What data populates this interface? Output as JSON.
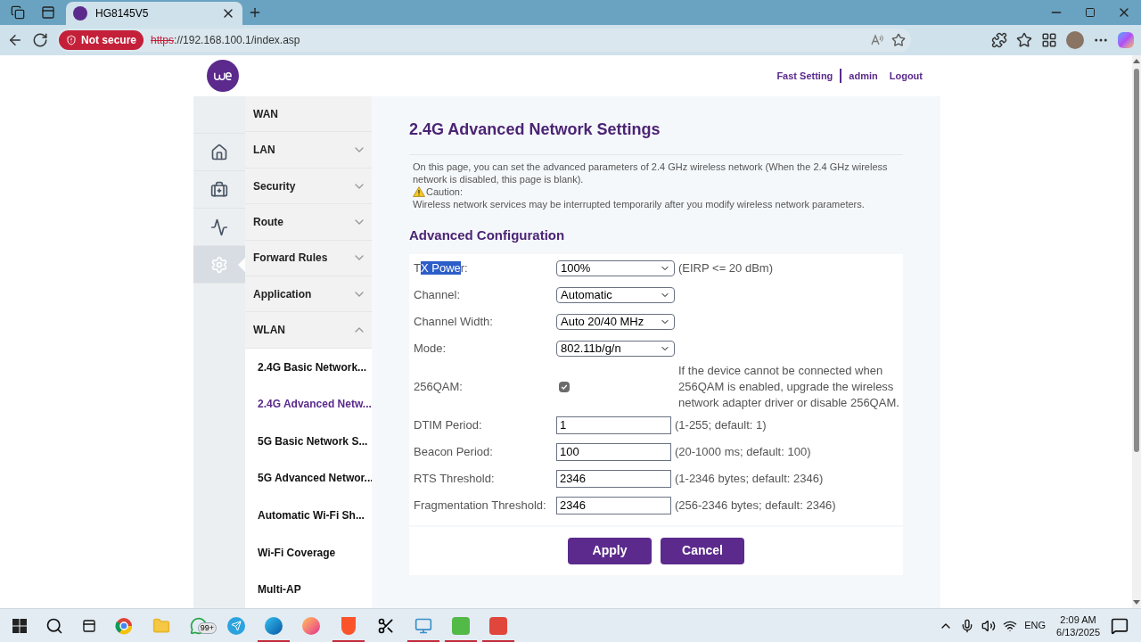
{
  "browser": {
    "tab_title": "HG8145V5",
    "security": "Not secure",
    "url_scheme": "https",
    "url_rest": "://192.168.100.1/index.asp"
  },
  "header": {
    "links": [
      "Fast Setting",
      "admin",
      "Logout"
    ]
  },
  "nav_icons": [
    {
      "kind": "home",
      "selected": false
    },
    {
      "kind": "kit",
      "selected": false
    },
    {
      "kind": "pulse",
      "selected": false
    },
    {
      "kind": "gear",
      "selected": true
    }
  ],
  "menu": [
    {
      "label": "WAN"
    },
    {
      "label": "LAN",
      "expanded": false
    },
    {
      "label": "Security",
      "expanded": false
    },
    {
      "label": "Route",
      "expanded": false
    },
    {
      "label": "Forward Rules",
      "expanded": false
    },
    {
      "label": "Application",
      "expanded": false
    },
    {
      "label": "WLAN",
      "expanded": true,
      "children": [
        {
          "label": "2.4G Basic Network...",
          "selected": false
        },
        {
          "label": "2.4G Advanced Netw...",
          "selected": true
        },
        {
          "label": "5G Basic Network S...",
          "selected": false
        },
        {
          "label": "5G Advanced Networ...",
          "selected": false
        },
        {
          "label": "Automatic Wi-Fi Sh...",
          "selected": false
        },
        {
          "label": "Wi-Fi Coverage",
          "selected": false
        },
        {
          "label": "Multi-AP",
          "selected": false
        }
      ]
    }
  ],
  "page": {
    "title": "2.4G Advanced Network Settings",
    "intro": "On this page, you can set the advanced parameters of 2.4 GHz wireless network (When the 2.4 GHz wireless network is disabled, this page is blank).",
    "caution": "Caution:",
    "caution_text": "Wireless network services may be interrupted temporarily after you modify wireless network parameters.",
    "section": "Advanced Configuration"
  },
  "fields": [
    {
      "kind": "select",
      "label_pre": "T",
      "label_selected": "X Powe",
      "label_post": "r:",
      "value": "100%",
      "hint": "(EIRP <= 20 dBm)"
    },
    {
      "kind": "select",
      "label_pre": "Channel:",
      "value": "Automatic"
    },
    {
      "kind": "select",
      "label_pre": "Channel Width:",
      "value": "Auto 20/40 MHz"
    },
    {
      "kind": "select",
      "label_pre": "Mode:",
      "value": "802.11b/g/n"
    },
    {
      "kind": "checkbox",
      "label_pre": "256QAM:",
      "checked": true,
      "hint": "If the device cannot be connected when 256QAM is enabled, upgrade the wireless network adapter driver or disable 256QAM."
    },
    {
      "kind": "input",
      "label_pre": "DTIM Period:",
      "value": "1",
      "hint": "(1-255; default: 1)"
    },
    {
      "kind": "input",
      "label_pre": "Beacon Period:",
      "value": "100",
      "hint": "(20-1000 ms; default: 100)"
    },
    {
      "kind": "input",
      "label_pre": "RTS Threshold:",
      "value": "2346",
      "hint": "(1-2346 bytes; default: 2346)"
    },
    {
      "kind": "input",
      "label_pre": "Fragmentation Threshold:",
      "value": "2346",
      "hint": "(256-2346 bytes; default: 2346)"
    }
  ],
  "buttons": [
    "Apply",
    "Cancel"
  ],
  "taskbar": {
    "apps": [
      {
        "kind": "browser",
        "running": false
      },
      {
        "kind": "folder",
        "running": false
      },
      {
        "kind": "chat",
        "running": false,
        "badge": "99+"
      },
      {
        "kind": "plane",
        "running": false
      },
      {
        "kind": "wave",
        "running": true
      },
      {
        "kind": "fox",
        "running": false
      },
      {
        "kind": "lion",
        "running": true
      },
      {
        "kind": "cut",
        "running": false
      },
      {
        "kind": "screen",
        "running": true
      },
      {
        "kind": "green",
        "running": true
      },
      {
        "kind": "red",
        "running": true
      }
    ],
    "language": "ENG",
    "time": "2:09 AM",
    "date": "6/13/2025"
  }
}
